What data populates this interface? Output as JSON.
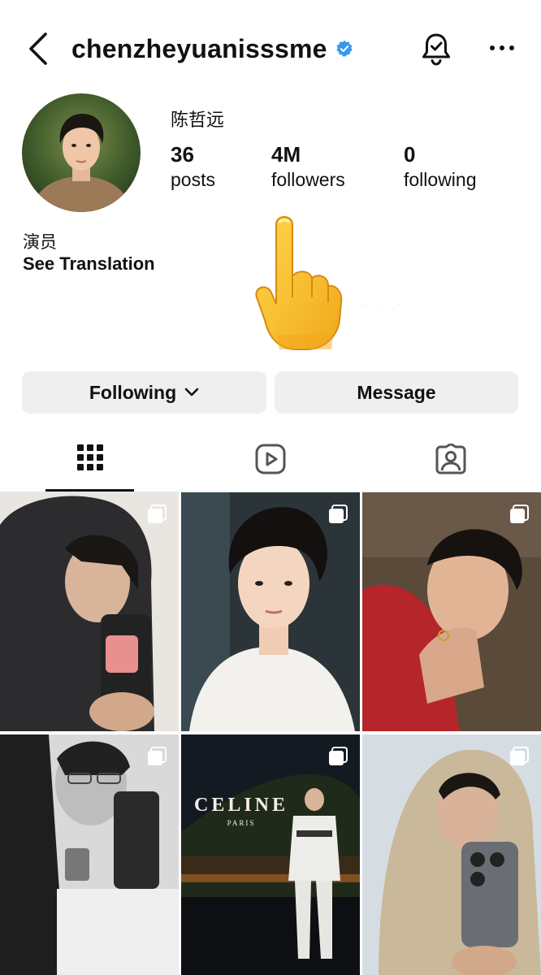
{
  "header": {
    "username": "chenzheyuanisssme",
    "verified": true,
    "icons": [
      "back-arrow-icon",
      "verified-badge-icon",
      "notification-bell-icon",
      "more-options-icon"
    ]
  },
  "profile": {
    "display_name": "陈哲远",
    "bio": "演员",
    "see_translation": "See Translation",
    "stats": {
      "posts": {
        "value": "36",
        "label": "posts"
      },
      "followers": {
        "value": "4M",
        "label": "followers"
      },
      "following": {
        "value": "0",
        "label": "following"
      }
    }
  },
  "overlay": {
    "emoji": "👆",
    "faint_dots": "· · ·"
  },
  "actions": {
    "following_label": "Following",
    "message_label": "Message"
  },
  "tabs": [
    {
      "name": "posts-grid",
      "icon": "grid-icon",
      "selected": true
    },
    {
      "name": "reels",
      "icon": "reels-icon",
      "selected": false
    },
    {
      "name": "tagged",
      "icon": "tagged-person-icon",
      "selected": false
    }
  ],
  "grid": {
    "multi_photo_icon": "multiple-photos-icon",
    "celine_logo_text": "CELINE",
    "celine_logo_subtext": "PARIS",
    "colors": {
      "tile_1": "#3a3a3a",
      "tile_2": "#e8e8e6",
      "tile_3": "#b4262a",
      "tile_4": "#8c8c8c",
      "tile_5": "#1b1f24",
      "tile_6": "#c9b89a"
    }
  },
  "colors": {
    "verified_blue": "#3897f0",
    "button_bg": "#efefef",
    "text": "#111111"
  }
}
